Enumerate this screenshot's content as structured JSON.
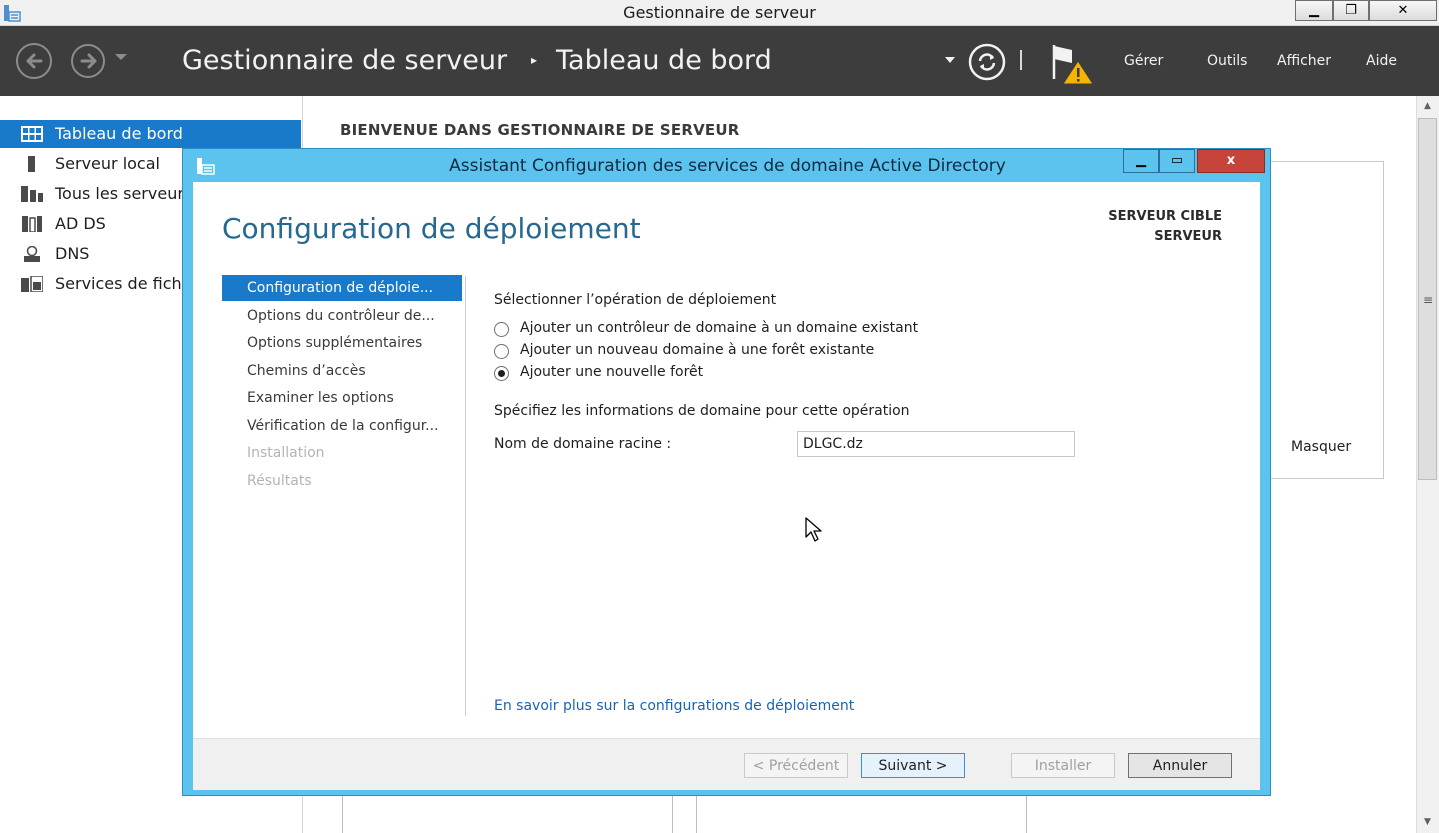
{
  "outer_window": {
    "title": "Gestionnaire de serveur",
    "minimize": "▁",
    "maximize": "❐",
    "close": "✕"
  },
  "header": {
    "breadcrumb_root": "Gestionnaire de serveur",
    "breadcrumb_separator": "▸",
    "breadcrumb_page": "Tableau de bord",
    "menu": {
      "manage": "Gérer",
      "tools": "Outils",
      "view": "Afficher",
      "help": "Aide"
    }
  },
  "sidebar": {
    "items": [
      {
        "label": "Tableau de bord",
        "icon": "dashboard-icon",
        "active": true
      },
      {
        "label": "Serveur local",
        "icon": "server-icon",
        "active": false
      },
      {
        "label": "Tous les serveurs",
        "icon": "all-servers-icon",
        "active": false
      },
      {
        "label": "AD DS",
        "icon": "ad-ds-icon",
        "active": false
      },
      {
        "label": "DNS",
        "icon": "dns-icon",
        "active": false
      },
      {
        "label": "Services de fichiers",
        "icon": "file-services-icon",
        "active": false
      }
    ]
  },
  "main": {
    "welcome_heading": "BIENVENUE DANS GESTIONNAIRE DE SERVEUR",
    "hide_label": "Masquer"
  },
  "wizard": {
    "title": "Assistant Configuration des services de domaine Active Directory",
    "minimize": "▁",
    "maximize": "▭",
    "close": "x",
    "page_title": "Configuration de déploiement",
    "target_label": "SERVEUR CIBLE",
    "target_name": "SERVEUR",
    "steps": [
      {
        "label": "Configuration de déploie...",
        "state": "active"
      },
      {
        "label": "Options du contrôleur de...",
        "state": "normal"
      },
      {
        "label": "Options supplémentaires",
        "state": "normal"
      },
      {
        "label": "Chemins d’accès",
        "state": "normal"
      },
      {
        "label": "Examiner les options",
        "state": "normal"
      },
      {
        "label": "Vérification de la configur...",
        "state": "normal"
      },
      {
        "label": "Installation",
        "state": "disabled"
      },
      {
        "label": "Résultats",
        "state": "disabled"
      }
    ],
    "operation_label": "Sélectionner l’opération de déploiement",
    "options": [
      {
        "label": "Ajouter un contrôleur de domaine à un domaine existant",
        "selected": false
      },
      {
        "label": "Ajouter un nouveau domaine à une forêt existante",
        "selected": false
      },
      {
        "label": "Ajouter une nouvelle forêt",
        "selected": true
      }
    ],
    "info_label": "Spécifiez les informations de domaine pour cette opération",
    "domain_label": "Nom de domaine racine :",
    "domain_value": "DLGC.dz",
    "learn_more_link": "En savoir plus sur la configurations de déploiement",
    "buttons": {
      "previous": "< Précédent",
      "next": "Suivant >",
      "install": "Installer",
      "cancel": "Annuler"
    }
  },
  "colors": {
    "header_bg": "#3d3d3d",
    "accent": "#1979ca",
    "wizard_frame": "#5cc3ee",
    "wizard_title_text": "#26688f",
    "close_red": "#c7443b",
    "link": "#1a63b3"
  }
}
